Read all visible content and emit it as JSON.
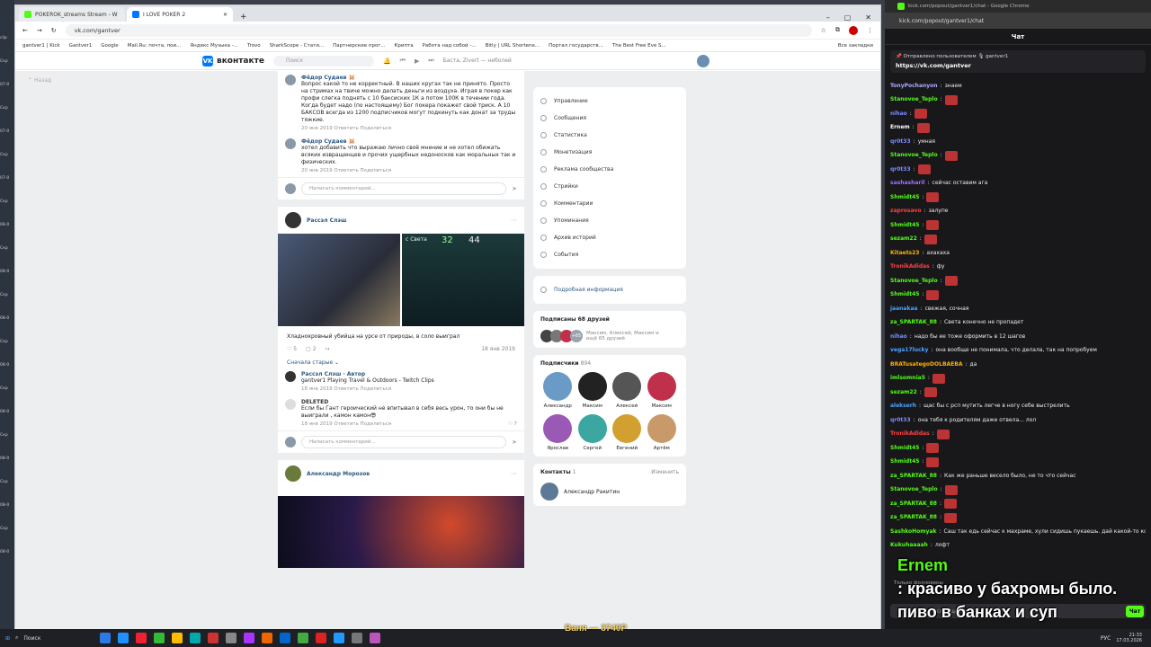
{
  "browser_left": {
    "tabs": [
      {
        "title": "POKEROK_streams Stream - W",
        "color": "#53fc18"
      },
      {
        "title": "I LOVE POKER 2",
        "color": "#0077ff"
      }
    ],
    "url": "vk.com/gantver",
    "bookmarks": [
      "gantver1 | Kick",
      "Gantver1",
      "Google",
      "Mail.Ru: почта, пои...",
      "Яндекс Музыка -...",
      "Trovo",
      "SharkScope - Стати...",
      "Партнерские прог...",
      "Крипта",
      "Работа над собой -...",
      "Bitly | URL Shortene...",
      "Портал государств...",
      "The Best Free Eve S..."
    ],
    "all_bookmarks": "Все закладки"
  },
  "vk": {
    "logo": "вконтакте",
    "search_placeholder": "Поиск",
    "player": "Баста, Zivert — неболей",
    "back": "Назад",
    "comments_top": [
      {
        "name": "Фёдор Судаев 🐹",
        "text": "Вопрос какой то не корректный. В наших кругах так не принято. Просто на стримах на твиче можно делать деньги из воздуха. Играя в покер как профи слегка поднять с 10 баксиских 1К а потом 100К в течении года. Когда будет надо (по настоящему) Бог покера покажет свой триск. А 10 БАКСОВ всегда из 1200 подписчиков могут подкинуть как донат за труды тяжкие.",
        "meta": "20 янв 2019  Ответить  Поделиться"
      },
      {
        "name": "Фёдор Судаев 🐹",
        "text": "хотел добавить что выражаю лично своё мнение и не хотел обижать всяких извращенцев и прочих ущербных недоносков как моральных так и физических.",
        "meta": "20 янв 2019  Ответить  Поделиться"
      }
    ],
    "comment_placeholder": "Написать комментарий...",
    "post": {
      "author": "Рассэл Слэш",
      "caption": "Хладнокровный убийца на урсе от природы, в соло выиграл",
      "likes": "5",
      "comments": "2",
      "date": "18 янв 2019",
      "sort": "Сначала старые",
      "img_text": "с Света",
      "img_num1": "32",
      "img_num2": "44"
    },
    "comments_post": [
      {
        "name": "Рассэл Слэш · Автор",
        "text": "gantver1 Playing Travel & Outdoors - Twitch Clips",
        "meta": "18 янв 2019  Ответить  Поделиться"
      },
      {
        "name": "DELETED",
        "text": "Если бы Гант героический не впитывал в себя весь урон, то они бы не выиграли , камон камон😎",
        "meta": "18 янв 2019  Ответить  Поделиться",
        "likes": "7"
      }
    ],
    "post2_author": "Александр Морозов",
    "menu": [
      "Управление",
      "Сообщения",
      "Статистика",
      "Монетизация",
      "Реклама сообщества",
      "Стрийки",
      "Комментарии",
      "Упоминания",
      "Архив историй",
      "События"
    ],
    "details": "Подробная информация",
    "friends_title": "Подписаны 68 друзей",
    "friends_names": "Максим, Алексей, Максим и ещё 65 друзей",
    "friends_more": "+65",
    "subs_title": "Подписчики",
    "subs_count": "894",
    "subs": [
      {
        "name": "Александр",
        "color": "#6a9bc7"
      },
      {
        "name": "Максим",
        "color": "#222"
      },
      {
        "name": "Алексей",
        "color": "#555"
      },
      {
        "name": "Максим",
        "color": "#c0304a"
      },
      {
        "name": "Ярослав",
        "color": "#9b59b6"
      },
      {
        "name": "Сергей",
        "color": "#3ba7a0"
      },
      {
        "name": "Евгений",
        "color": "#d2a030"
      },
      {
        "name": "Артём",
        "color": "#c89a6a"
      }
    ],
    "contacts_title": "Контакты",
    "contacts_count": "1",
    "contacts_edit": "Изменить",
    "contact_name": "Александр Ракитин"
  },
  "chat": {
    "window_title": "kick.com/popout/gantver1/chat - Google Chrome",
    "url": "kick.com/popout/gantver1/chat",
    "title": "Чат",
    "pinned_by": "📌 Отправлено пользователем 🎙 gantver1",
    "pinned_link": "https://vk.com/gantver",
    "messages": [
      {
        "user": "TonyPochanyon",
        "text": "знаем",
        "color": "#aaaaff"
      },
      {
        "user": "Stanovoe_Teplo",
        "text": "",
        "color": "#53fc18",
        "emote": true
      },
      {
        "user": "nihao",
        "text": "",
        "color": "#7c8cff",
        "emote": true
      },
      {
        "user": "Ernem",
        "text": "",
        "color": "#ffffff",
        "emote": true
      },
      {
        "user": "qr0t33",
        "text": "умная",
        "color": "#7c8cff"
      },
      {
        "user": "Stanovoe_Teplo",
        "text": "",
        "color": "#53fc18",
        "emote": true
      },
      {
        "user": "qr0t33",
        "text": "",
        "color": "#7c8cff",
        "emote": true
      },
      {
        "user": "sashasharil",
        "text": "сейчас оставим ага",
        "color": "#a070ff"
      },
      {
        "user": "Shmidt45",
        "text": "",
        "color": "#53fc18",
        "emote": true
      },
      {
        "user": "zaprosavo",
        "text": "залупе",
        "color": "#ff4040"
      },
      {
        "user": "Shmidt45",
        "text": "",
        "color": "#53fc18",
        "emote": true
      },
      {
        "user": "sezam22",
        "text": "",
        "color": "#53fc18",
        "emote": true
      },
      {
        "user": "Kitaets23",
        "text": "ахахаха",
        "color": "#ffb000"
      },
      {
        "user": "TronikAdidas",
        "text": "фу",
        "color": "#ff4040"
      },
      {
        "user": "Stanovoe_Teplo",
        "text": "",
        "color": "#53fc18",
        "emote": true
      },
      {
        "user": "Shmidt45",
        "text": "",
        "color": "#53fc18",
        "emote": true
      },
      {
        "user": "jaanakaa",
        "text": "свежая, сочная",
        "color": "#4aa3ff"
      },
      {
        "user": "za_SPARTAK_88",
        "text": "Света конечно не пропадет",
        "color": "#53fc18"
      },
      {
        "user": "nihao",
        "text": "надо бы ее тоже оформить в 12 шагов",
        "color": "#7c8cff"
      },
      {
        "user": "vega17lucky",
        "text": "она вообще не понимала, что делала, так на попробуем",
        "color": "#4aa3ff"
      },
      {
        "user": "BRATusategoDOLBAEBA",
        "text": "да",
        "color": "#ffb000"
      },
      {
        "user": "imlsomnia5",
        "text": "",
        "color": "#53fc18",
        "emote": true
      },
      {
        "user": "sezam22",
        "text": "",
        "color": "#53fc18",
        "emote": true
      },
      {
        "user": "alekserh",
        "text": "щас бы с рсп мутить легче в ногу себе выстрелить",
        "color": "#4aa3ff"
      },
      {
        "user": "qr0t33",
        "text": "она тебя к родителям даже отвела... лол",
        "color": "#7c8cff"
      },
      {
        "user": "TronikAdidas",
        "text": "",
        "color": "#ff4040",
        "emote": true
      },
      {
        "user": "Shmidt45",
        "text": "",
        "color": "#53fc18",
        "emote": true
      },
      {
        "user": "Shmidt45",
        "text": "",
        "color": "#53fc18",
        "emote": true
      },
      {
        "user": "za_SPARTAK_88",
        "text": "Как же раньше весело было, не то что сейчас",
        "color": "#53fc18"
      },
      {
        "user": "Stanovoe_Teplo",
        "text": "",
        "color": "#53fc18",
        "emote": true
      },
      {
        "user": "za_SPARTAK_88",
        "text": "",
        "color": "#53fc18",
        "emote": true
      },
      {
        "user": "za_SPARTAK_88",
        "text": "",
        "color": "#53fc18",
        "emote": true
      },
      {
        "user": "SashkoHomyak",
        "text": "Саш так едь сейчас к махраме, хули сидишь пукаешь. дай какой-то контент",
        "color": "#53fc18"
      },
      {
        "user": "Kukuhaaaah",
        "text": "лофт",
        "color": "#53fc18"
      }
    ],
    "followers_only": "Только фолловеры",
    "input_placeholder": "Отправить сообщение",
    "send": "Чат",
    "overlay_name": "Ernem",
    "overlay_text": ": красиво у бахромы было. пиво в банках и суп"
  },
  "donation": "Ваня — 3740Р",
  "taskbar": {
    "search": "Поиск",
    "time": "21:33",
    "date": "17.03.2026",
    "lang": "РУС"
  },
  "desktop_labels": [
    "clip",
    "Скр",
    "07-0",
    "Скр",
    "07-0",
    "Скр",
    "07-0",
    "Скр",
    "08-0",
    "Скр",
    "08-0",
    "Скр",
    "08-0",
    "Скр",
    "08-0",
    "Скр",
    "08-0",
    "Скр",
    "08-0",
    "Скр",
    "08-0",
    "Скр",
    "08-0"
  ]
}
